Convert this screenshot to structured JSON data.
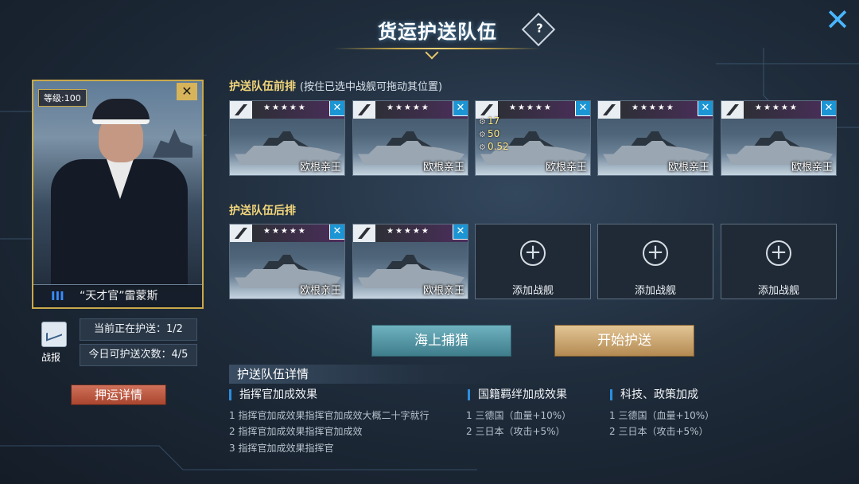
{
  "header": {
    "title": "货运护送队伍",
    "help_glyph": "?",
    "close_glyph": "✕"
  },
  "commander": {
    "level": "等级:100",
    "remove_glyph": "✕",
    "rank": "III",
    "name": "“天才官”雷蒙斯"
  },
  "report": {
    "label": "战报"
  },
  "status": {
    "escorting": "当前正在护送：1/2",
    "remaining": "今日可护送次数：4/5"
  },
  "escort_detail_button": "押运详情",
  "front_row": {
    "title": "护送队伍前排",
    "note": "(按住已选中战舰可拖动其位置)",
    "ships": [
      {
        "name": "欧根亲王",
        "stars": "★★★★★",
        "remove": "✕"
      },
      {
        "name": "欧根亲王",
        "stars": "★★★★★",
        "remove": "✕"
      },
      {
        "name": "欧根亲王",
        "stars": "★★★★★",
        "remove": "✕",
        "stats": [
          "17",
          "50",
          "0.52"
        ]
      },
      {
        "name": "欧根亲王",
        "stars": "★★★★★",
        "remove": "✕"
      },
      {
        "name": "欧根亲王",
        "stars": "★★★★★",
        "remove": "✕"
      }
    ]
  },
  "back_row": {
    "title": "护送队伍后排",
    "ships": [
      {
        "name": "欧根亲王",
        "stars": "★★★★★",
        "remove": "✕"
      },
      {
        "name": "欧根亲王",
        "stars": "★★★★★",
        "remove": "✕"
      }
    ],
    "empty_slots": [
      "添加战舰",
      "添加战舰",
      "添加战舰"
    ],
    "plus_glyph": "+"
  },
  "actions": {
    "hunt": "海上捕猎",
    "start": "开始护送"
  },
  "details": {
    "title": "护送队伍详情",
    "columns": [
      {
        "heading": "指挥官加成效果",
        "lines": [
          "1 指挥官加成效果指挥官加成效大概二十字就行",
          "2 指挥官加成效果指挥官加成效",
          "3 指挥官加成效果指挥官"
        ]
      },
      {
        "heading": "国籍羁绊加成效果",
        "lines": [
          "1 三德国（血量+10%）",
          "2 三日本（攻击+5%）"
        ]
      },
      {
        "heading": "科技、政策加成",
        "lines": [
          "1 三德国（血量+10%）",
          "2 三日本（攻击+5%）"
        ]
      }
    ]
  },
  "colors": {
    "accent_gold": "#c9a94a",
    "accent_blue": "#1b95d4",
    "button_hunt": "#4f95a3",
    "button_start": "#c9a46e",
    "button_escort": "#b9543d"
  }
}
